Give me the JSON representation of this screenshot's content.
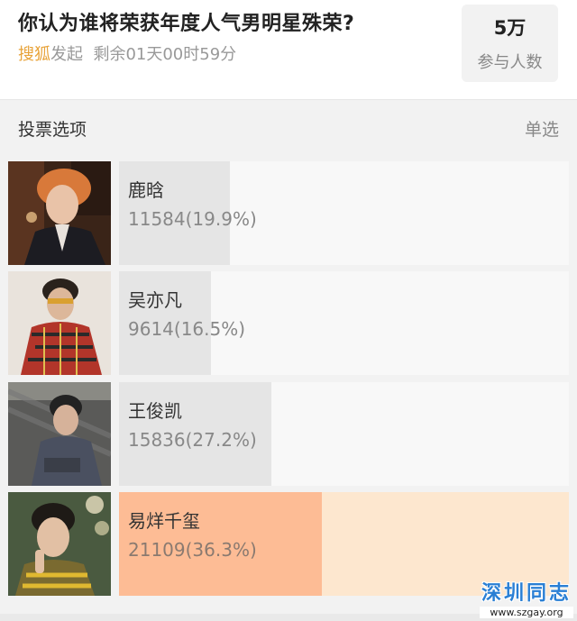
{
  "poll": {
    "title": "你认为谁将荣获年度人气男明星殊荣?",
    "source": "搜狐",
    "source_suffix": "发起",
    "remaining": "剩余01天00时59分",
    "participants_count": "5万",
    "participants_label": "参与人数"
  },
  "section": {
    "title": "投票选项",
    "mode": "单选"
  },
  "options": [
    {
      "name": "鹿晗",
      "votes_text": "11584(19.9%)",
      "share": 0.199
    },
    {
      "name": "吴亦凡",
      "votes_text": "9614(16.5%)",
      "share": 0.165
    },
    {
      "name": "王俊凯",
      "votes_text": "15836(27.2%)",
      "share": 0.272
    },
    {
      "name": "易烊千玺",
      "votes_text": "21109(36.3%)",
      "share": 0.363,
      "leading": true
    }
  ],
  "watermark": {
    "title": "深圳同志",
    "url": "www.szgay.org"
  },
  "colors": {
    "source_accent": "#e8a33a",
    "bar_default": "#e5e5e5",
    "bar_leading": "#fdbc95",
    "bar_leading_bg": "#fde7cf",
    "watermark": "#2a7fd4"
  }
}
